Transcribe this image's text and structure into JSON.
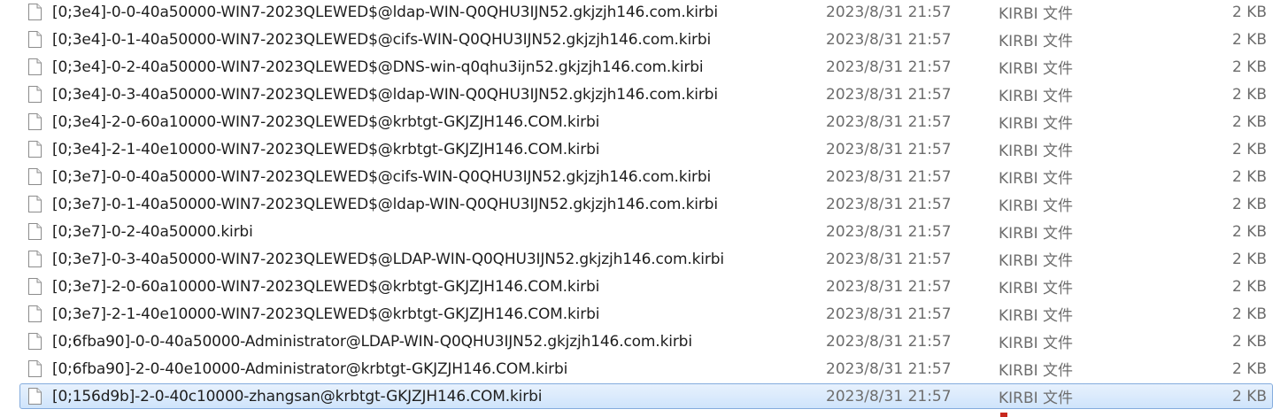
{
  "colors": {
    "selected_bg": "#cfe4fb",
    "selected_border": "#84acdd",
    "text_primary": "#1e1e1e",
    "text_secondary": "#6d6d6d"
  },
  "files": [
    {
      "name": "[0;3e4]-0-0-40a50000-WIN7-2023QLEWED$@ldap-WIN-Q0QHU3IJN52.gkjzjh146.com.kirbi",
      "date": "2023/8/31 21:57",
      "type": "KIRBI 文件",
      "size": "2 KB",
      "icon": "blank-file-icon",
      "selected": false
    },
    {
      "name": "[0;3e4]-0-1-40a50000-WIN7-2023QLEWED$@cifs-WIN-Q0QHU3IJN52.gkjzjh146.com.kirbi",
      "date": "2023/8/31 21:57",
      "type": "KIRBI 文件",
      "size": "2 KB",
      "icon": "blank-file-icon",
      "selected": false
    },
    {
      "name": "[0;3e4]-0-2-40a50000-WIN7-2023QLEWED$@DNS-win-q0qhu3ijn52.gkjzjh146.com.kirbi",
      "date": "2023/8/31 21:57",
      "type": "KIRBI 文件",
      "size": "2 KB",
      "icon": "blank-file-icon",
      "selected": false
    },
    {
      "name": "[0;3e4]-0-3-40a50000-WIN7-2023QLEWED$@ldap-WIN-Q0QHU3IJN52.gkjzjh146.com.kirbi",
      "date": "2023/8/31 21:57",
      "type": "KIRBI 文件",
      "size": "2 KB",
      "icon": "blank-file-icon",
      "selected": false
    },
    {
      "name": "[0;3e4]-2-0-60a10000-WIN7-2023QLEWED$@krbtgt-GKJZJH146.COM.kirbi",
      "date": "2023/8/31 21:57",
      "type": "KIRBI 文件",
      "size": "2 KB",
      "icon": "blank-file-icon",
      "selected": false
    },
    {
      "name": "[0;3e4]-2-1-40e10000-WIN7-2023QLEWED$@krbtgt-GKJZJH146.COM.kirbi",
      "date": "2023/8/31 21:57",
      "type": "KIRBI 文件",
      "size": "2 KB",
      "icon": "blank-file-icon",
      "selected": false
    },
    {
      "name": "[0;3e7]-0-0-40a50000-WIN7-2023QLEWED$@cifs-WIN-Q0QHU3IJN52.gkjzjh146.com.kirbi",
      "date": "2023/8/31 21:57",
      "type": "KIRBI 文件",
      "size": "2 KB",
      "icon": "blank-file-icon",
      "selected": false
    },
    {
      "name": "[0;3e7]-0-1-40a50000-WIN7-2023QLEWED$@ldap-WIN-Q0QHU3IJN52.gkjzjh146.com.kirbi",
      "date": "2023/8/31 21:57",
      "type": "KIRBI 文件",
      "size": "2 KB",
      "icon": "blank-file-icon",
      "selected": false
    },
    {
      "name": "[0;3e7]-0-2-40a50000.kirbi",
      "date": "2023/8/31 21:57",
      "type": "KIRBI 文件",
      "size": "2 KB",
      "icon": "blank-file-icon",
      "selected": false
    },
    {
      "name": "[0;3e7]-0-3-40a50000-WIN7-2023QLEWED$@LDAP-WIN-Q0QHU3IJN52.gkjzjh146.com.kirbi",
      "date": "2023/8/31 21:57",
      "type": "KIRBI 文件",
      "size": "2 KB",
      "icon": "blank-file-icon",
      "selected": false
    },
    {
      "name": "[0;3e7]-2-0-60a10000-WIN7-2023QLEWED$@krbtgt-GKJZJH146.COM.kirbi",
      "date": "2023/8/31 21:57",
      "type": "KIRBI 文件",
      "size": "2 KB",
      "icon": "blank-file-icon",
      "selected": false
    },
    {
      "name": "[0;3e7]-2-1-40e10000-WIN7-2023QLEWED$@krbtgt-GKJZJH146.COM.kirbi",
      "date": "2023/8/31 21:57",
      "type": "KIRBI 文件",
      "size": "2 KB",
      "icon": "blank-file-icon",
      "selected": false
    },
    {
      "name": "[0;6fba90]-0-0-40a50000-Administrator@LDAP-WIN-Q0QHU3IJN52.gkjzjh146.com.kirbi",
      "date": "2023/8/31 21:57",
      "type": "KIRBI 文件",
      "size": "2 KB",
      "icon": "blank-file-icon",
      "selected": false
    },
    {
      "name": "[0;6fba90]-2-0-40e10000-Administrator@krbtgt-GKJZJH146.COM.kirbi",
      "date": "2023/8/31 21:57",
      "type": "KIRBI 文件",
      "size": "2 KB",
      "icon": "blank-file-icon",
      "selected": false
    },
    {
      "name": "[0;156d9b]-2-0-40c10000-zhangsan@krbtgt-GKJZJH146.COM.kirbi",
      "date": "2023/8/31 21:57",
      "type": "KIRBI 文件",
      "size": "2 KB",
      "icon": "blank-file-icon",
      "selected": true
    }
  ]
}
